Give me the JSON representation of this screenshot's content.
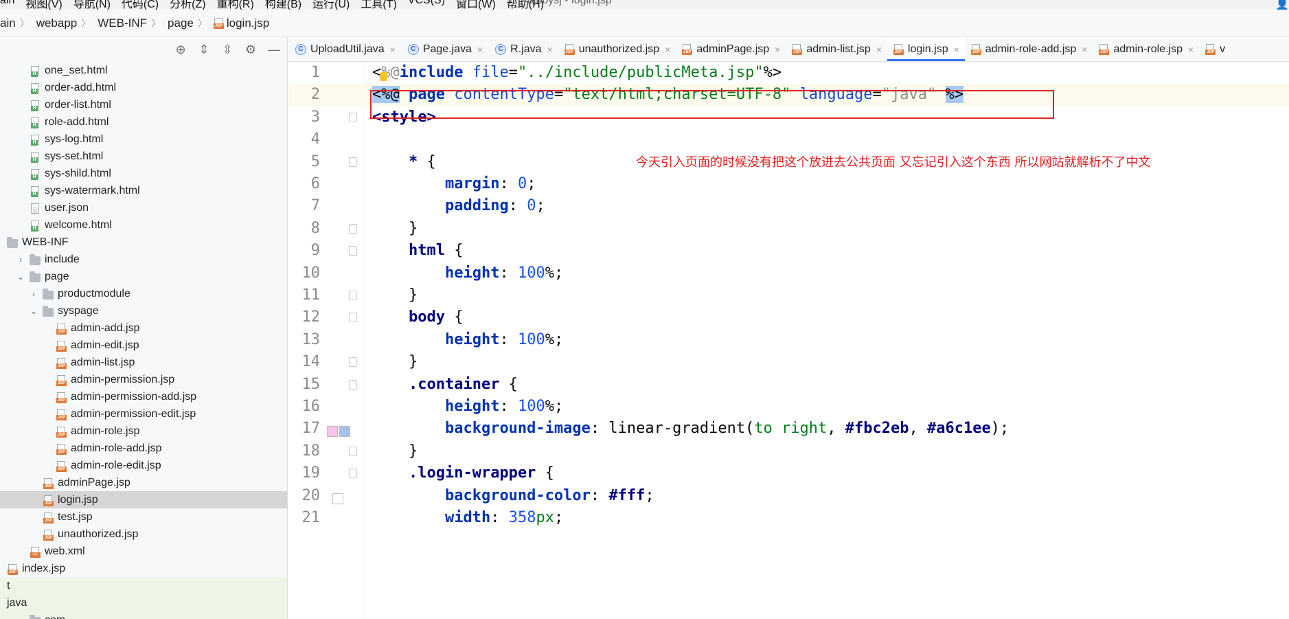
{
  "menubar": {
    "items": [
      "ain",
      "视图(V)",
      "导航(N)",
      "代码(C)",
      "分析(Z)",
      "重构(R)",
      "构建(B)",
      "运行(U)",
      "工具(T)",
      "VCS(S)",
      "窗口(W)",
      "帮助(H)"
    ],
    "window_title": "bjhbysj - login.jsp"
  },
  "breadcrumb": {
    "items": [
      "ain",
      "webapp",
      "WEB-INF",
      "page",
      "login.jsp"
    ]
  },
  "project_tree": {
    "rows": [
      {
        "label": "one_set.html",
        "icon": "html-file-icon",
        "indent": 1
      },
      {
        "label": "order-add.html",
        "icon": "html-file-icon",
        "indent": 1
      },
      {
        "label": "order-list.html",
        "icon": "html-file-icon",
        "indent": 1
      },
      {
        "label": "role-add.html",
        "icon": "html-file-icon",
        "indent": 1
      },
      {
        "label": "sys-log.html",
        "icon": "html-file-icon",
        "indent": 1
      },
      {
        "label": "sys-set.html",
        "icon": "html-file-icon",
        "indent": 1
      },
      {
        "label": "sys-shild.html",
        "icon": "html-file-icon",
        "indent": 1
      },
      {
        "label": "sys-watermark.html",
        "icon": "html-file-icon",
        "indent": 1
      },
      {
        "label": "user.json",
        "icon": "json-file-icon",
        "indent": 1
      },
      {
        "label": "welcome.html",
        "icon": "html-file-icon",
        "indent": 1
      },
      {
        "label": "WEB-INF",
        "icon": "folder-icon",
        "indent": 0
      },
      {
        "label": "include",
        "icon": "folder-icon",
        "indent": 1,
        "arrow": "collapsed"
      },
      {
        "label": "page",
        "icon": "folder-icon",
        "indent": 1,
        "arrow": "expanded"
      },
      {
        "label": "productmodule",
        "icon": "folder-icon",
        "indent": 2,
        "arrow": "collapsed"
      },
      {
        "label": "syspage",
        "icon": "folder-icon",
        "indent": 2,
        "arrow": "expanded"
      },
      {
        "label": "admin-add.jsp",
        "icon": "jsp-file-icon",
        "indent": 3
      },
      {
        "label": "admin-edit.jsp",
        "icon": "jsp-file-icon",
        "indent": 3
      },
      {
        "label": "admin-list.jsp",
        "icon": "jsp-file-icon",
        "indent": 3
      },
      {
        "label": "admin-permission.jsp",
        "icon": "jsp-file-icon",
        "indent": 3
      },
      {
        "label": "admin-permission-add.jsp",
        "icon": "jsp-file-icon",
        "indent": 3
      },
      {
        "label": "admin-permission-edit.jsp",
        "icon": "jsp-file-icon",
        "indent": 3
      },
      {
        "label": "admin-role.jsp",
        "icon": "jsp-file-icon",
        "indent": 3
      },
      {
        "label": "admin-role-add.jsp",
        "icon": "jsp-file-icon",
        "indent": 3
      },
      {
        "label": "admin-role-edit.jsp",
        "icon": "jsp-file-icon",
        "indent": 3
      },
      {
        "label": "adminPage.jsp",
        "icon": "jsp-file-icon",
        "indent": 2
      },
      {
        "label": "login.jsp",
        "icon": "jsp-file-icon",
        "indent": 2,
        "selected": true
      },
      {
        "label": "test.jsp",
        "icon": "jsp-file-icon",
        "indent": 2
      },
      {
        "label": "unauthorized.jsp",
        "icon": "jsp-file-icon",
        "indent": 2
      },
      {
        "label": "web.xml",
        "icon": "xml-file-icon",
        "indent": 1
      },
      {
        "label": "index.jsp",
        "icon": "jsp-file-icon",
        "indent": 0
      },
      {
        "label": "t",
        "icon": "",
        "indent": 0,
        "green": true
      },
      {
        "label": "java",
        "icon": "",
        "indent": 0,
        "green": true
      },
      {
        "label": "com",
        "icon": "folder-icon",
        "indent": 1,
        "green": true
      }
    ]
  },
  "tabs": [
    {
      "label": "UploadUtil.java",
      "icon": "class-icon"
    },
    {
      "label": "Page.java",
      "icon": "class-icon"
    },
    {
      "label": "R.java",
      "icon": "class-icon"
    },
    {
      "label": "unauthorized.jsp",
      "icon": "jsp-file-icon"
    },
    {
      "label": "adminPage.jsp",
      "icon": "jsp-file-icon"
    },
    {
      "label": "admin-list.jsp",
      "icon": "jsp-file-icon"
    },
    {
      "label": "login.jsp",
      "icon": "jsp-file-icon",
      "active": true
    },
    {
      "label": "admin-role-add.jsp",
      "icon": "jsp-file-icon"
    },
    {
      "label": "admin-role.jsp",
      "icon": "jsp-file-icon"
    },
    {
      "label": "v",
      "icon": "jsp-file-icon"
    }
  ],
  "editor": {
    "line_numbers": [
      "1",
      "2",
      "3",
      "4",
      "5",
      "6",
      "7",
      "8",
      "9",
      "10",
      "11",
      "12",
      "13",
      "14",
      "15",
      "16",
      "17",
      "18",
      "19",
      "20",
      "21"
    ],
    "code_lines": [
      "<%@include file=\"../include/publicMeta.jsp\"%>",
      "<%@ page contentType=\"text/html;charset=UTF-8\" language=\"java\" %>",
      "<style>",
      "",
      "    * {",
      "        margin: 0;",
      "        padding: 0;",
      "    }",
      "    html {",
      "        height: 100%;",
      "    }",
      "    body {",
      "        height: 100%;",
      "    }",
      "    .container {",
      "        height: 100%;",
      "        background-image: linear-gradient(to right, #fbc2eb, #a6c1ee);",
      "    }",
      "    .login-wrapper {",
      "        background-color: #fff;",
      "        width: 358px;"
    ],
    "annotation_note": "今天引入页面的时候没有把这个放进去公共页面  又忘记引入这个东西  所以网站就解析不了中文",
    "swatch_colors": {
      "pink": "#fbc2eb",
      "blue": "#a6c1ee",
      "white": "#ffffff"
    }
  }
}
